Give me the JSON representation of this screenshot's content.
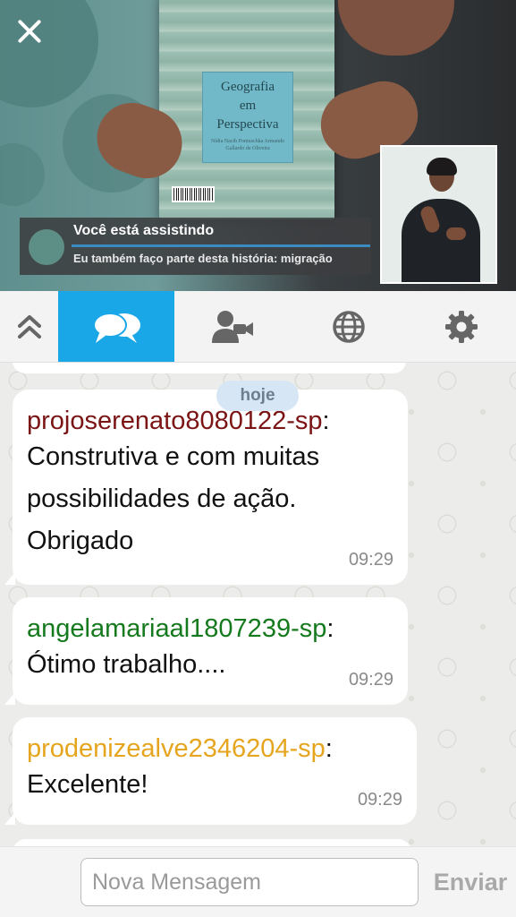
{
  "video": {
    "book": {
      "title": "Geografia\nem\nPerspectiva",
      "subtitle": "Nídia Nacib Pontuschka\nArmando Gallardo de Oliveira"
    },
    "now_watching": {
      "title": "Você está assistindo",
      "subtitle": "Eu também faço parte desta história: migração"
    }
  },
  "toolbar": {
    "items": [
      {
        "name": "collapse",
        "icon": "chevron-double-up-icon"
      },
      {
        "name": "chat",
        "icon": "chat-bubbles-icon",
        "active": true
      },
      {
        "name": "participants",
        "icon": "user-video-icon"
      },
      {
        "name": "language",
        "icon": "globe-icon"
      },
      {
        "name": "settings",
        "icon": "gear-icon"
      }
    ],
    "active_color": "#1aa7e8"
  },
  "chat": {
    "date_separator": "hoje",
    "messages": [
      {
        "user": "projoserenato8080122-sp",
        "user_color": "#7b1414",
        "text": "Construtiva e com muitas\npossibilidades de ação.\nObrigado",
        "time": "09:29"
      },
      {
        "user": "angelamariaal1807239-sp",
        "user_color": "#157a1d",
        "text": "Ótimo trabalho....",
        "time": "09:29"
      },
      {
        "user": "prodenizealve2346204-sp",
        "user_color": "#e6a51e",
        "text": "Excelente!",
        "time": "09:29"
      }
    ]
  },
  "composer": {
    "placeholder": "Nova Mensagem",
    "value": "",
    "send_label": "Enviar"
  }
}
